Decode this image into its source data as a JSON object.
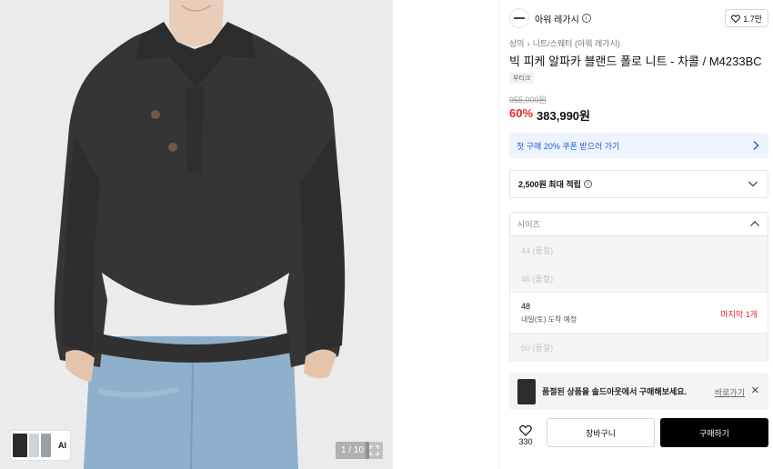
{
  "gallery": {
    "ai_label": "AI",
    "pager": "1 / 10"
  },
  "brand": {
    "name": "아워 레가시",
    "info_icon": "i",
    "likes": "1.7만"
  },
  "breadcrumb": {
    "root": "상의",
    "sep": "›",
    "category": "니트/스웨터 (아워 레가시)"
  },
  "product": {
    "title": "빅 피케 알파카 블랜드 폴로 니트 - 차콜 / M4233BC",
    "tag": "부티크",
    "original_price": "955,000원",
    "discount": "60%",
    "price": "383,990원"
  },
  "coupon": {
    "text": "첫 구매 20% 쿠폰 받으러 가기"
  },
  "points": {
    "text": "2,500원 최대 적립",
    "info_icon": "i"
  },
  "size_select": {
    "label": "사이즈"
  },
  "sizes": [
    {
      "label": "44 (품절)"
    },
    {
      "label": "46 (품절)"
    },
    {
      "label": "48",
      "sub": "내일(토) 도착 예정",
      "stock": "마지막 1개"
    },
    {
      "label": "50 (품절)"
    }
  ],
  "soldout_banner": {
    "text": "품절된 상품을 솔드아웃에서 구매해보세요.",
    "link": "바로가기",
    "close": "✕"
  },
  "actions": {
    "like_count": "330",
    "cart": "장바구니",
    "buy": "구매하기"
  },
  "colors": {
    "discount_red": "#e8262c",
    "coupon_blue": "#1a5ad4",
    "coupon_bg": "#eef4fd",
    "buy_button": "#000000"
  },
  "icons": [
    "heart-icon",
    "info-icon",
    "chevron-right-icon",
    "chevron-down-icon",
    "chevron-up-icon",
    "expand-icon",
    "close-icon"
  ]
}
